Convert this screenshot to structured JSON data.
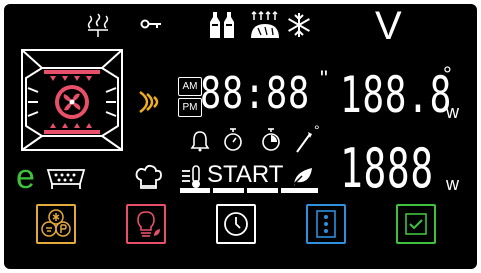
{
  "colors": {
    "background": "#000000",
    "segment": "#ffffff",
    "oven_red": "#e8506a",
    "heat_amber": "#f2b11c",
    "eco_green": "#3ec23e",
    "btn_recipes": "#e2a93b",
    "btn_light": "#e8506a",
    "btn_timer": "#ffffff",
    "btn_options": "#2f8fdc",
    "btn_confirm": "#3ec23e"
  },
  "display": {
    "voltage_symbol": "V",
    "clock_am": "AM",
    "clock_pm": "PM",
    "clock_digits": "88:88",
    "clock_seconds_mark": "\"",
    "power_top_digits": "188.8",
    "degree_symbol": "°",
    "power_top_unit": "w",
    "power_bottom_digits": "1888",
    "power_bottom_unit": "w",
    "start_label": "START",
    "eco_letter": "e",
    "meat_probe_degree": "°"
  },
  "icons": [
    "steam-top-icon",
    "key-lock-icon",
    "defrost-bottles-icon",
    "bake-bread-icon",
    "snowflake-icon",
    "oven-fan-icon",
    "heat-waves-icon",
    "bell-icon",
    "timer-start-icon",
    "timer-end-icon",
    "meat-probe-icon",
    "chef-hat-icon",
    "thermometer-icon",
    "leaf-icon",
    "tray-icon"
  ],
  "buttons": {
    "recipes": "recipes-button",
    "light": "light-button",
    "timer": "timer-button",
    "options": "options-button",
    "confirm": "confirm-button"
  }
}
